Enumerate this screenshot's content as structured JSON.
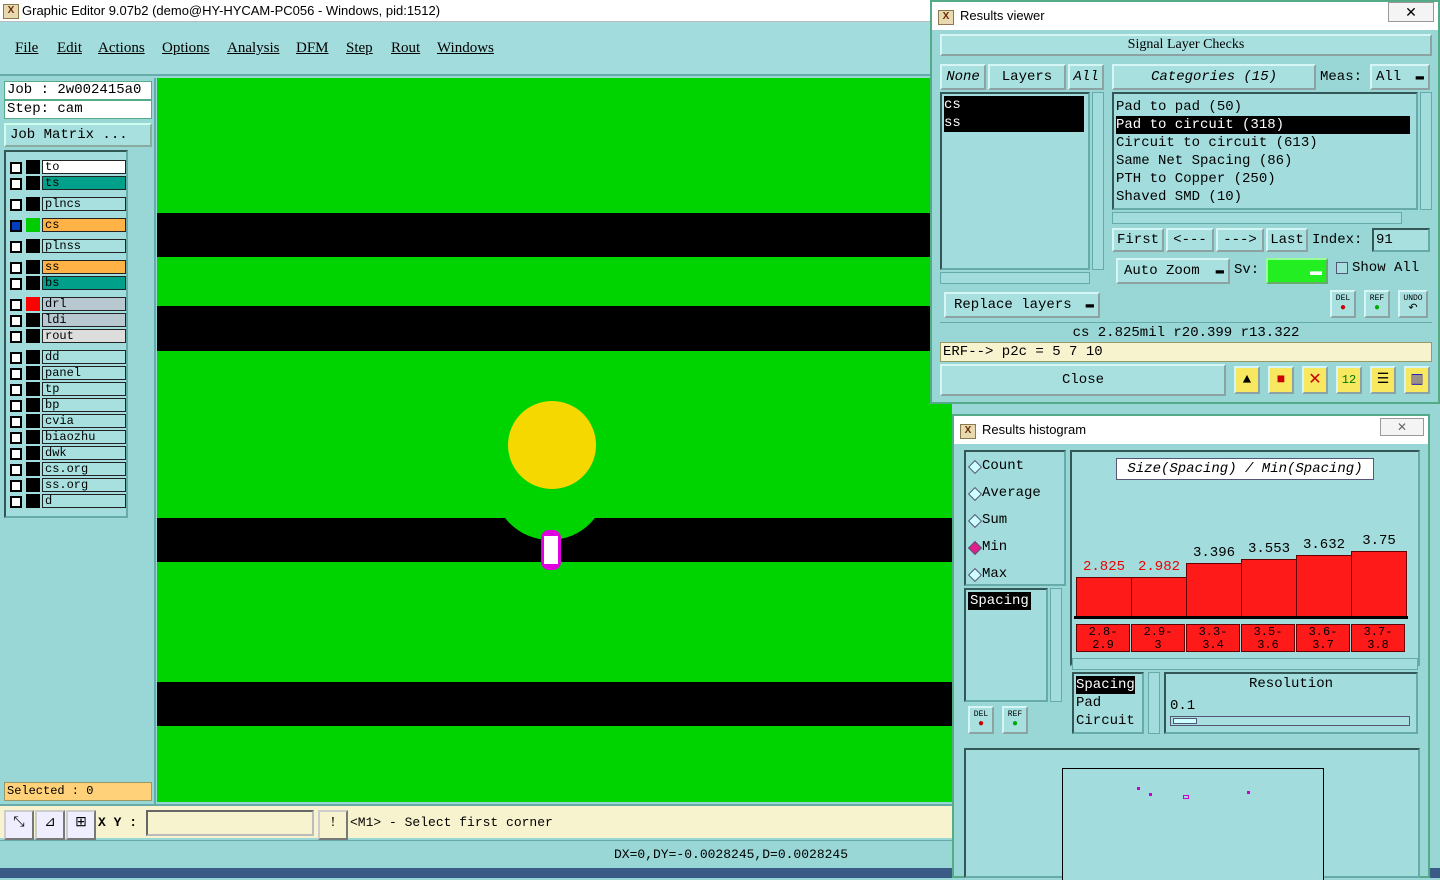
{
  "main_window": {
    "title": "Graphic Editor 9.07b2 (demo@HY-HYCAM-PC056 - Windows, pid:1512)",
    "menu": [
      "File",
      "Edit",
      "Actions",
      "Options",
      "Analysis",
      "DFM",
      "Step",
      "Rout",
      "Windows"
    ]
  },
  "left_panel": {
    "job": "Job : 2w002415a0",
    "step": "Step: cam",
    "job_matrix": "Job Matrix ...",
    "layers": [
      {
        "name": "to",
        "color": "#ffffff",
        "swatch": "#000000"
      },
      {
        "name": "ts",
        "color": "#00a08a",
        "swatch": "#000000"
      },
      {
        "name": "plncs",
        "color": "#a8e0e0",
        "swatch": "#000000"
      },
      {
        "name": "cs",
        "color": "#ffb347",
        "swatch": "#00cc00",
        "active": true
      },
      {
        "name": "plnss",
        "color": "#a8e0e0",
        "swatch": "#000000"
      },
      {
        "name": "ss",
        "color": "#ffb347",
        "swatch": "#000000"
      },
      {
        "name": "bs",
        "color": "#00a08a",
        "swatch": "#000000"
      },
      {
        "name": "drl",
        "color": "#b8c8d0",
        "swatch": "#ff0000"
      },
      {
        "name": "ldi",
        "color": "#b8c8d0",
        "swatch": "#000000"
      },
      {
        "name": "rout",
        "color": "#dddddd",
        "swatch": "#000000"
      },
      {
        "name": "dd",
        "color": "#a8e0e0",
        "swatch": "#000000"
      },
      {
        "name": "panel",
        "color": "#a8e0e0",
        "swatch": "#000000"
      },
      {
        "name": "tp",
        "color": "#a8e0e0",
        "swatch": "#000000"
      },
      {
        "name": "bp",
        "color": "#a8e0e0",
        "swatch": "#000000"
      },
      {
        "name": "cvia",
        "color": "#a8e0e0",
        "swatch": "#000000"
      },
      {
        "name": "biaozhu",
        "color": "#a8e0e0",
        "swatch": "#000000"
      },
      {
        "name": "dwk",
        "color": "#a8e0e0",
        "swatch": "#000000"
      },
      {
        "name": "cs.org",
        "color": "#a8e0e0",
        "swatch": "#000000"
      },
      {
        "name": "ss.org",
        "color": "#a8e0e0",
        "swatch": "#000000"
      },
      {
        "name": "d",
        "color": "#a8e0e0",
        "swatch": "#000000"
      }
    ],
    "selected": "Selected : 0"
  },
  "status": {
    "xy_label": "X Y :",
    "xy_value": "",
    "message": "<M1> - Select first corner",
    "dx": "DX=0,DY=-0.0028245,D=0.0028245"
  },
  "results_viewer": {
    "title": "Results viewer",
    "header": "Signal Layer Checks",
    "none_label": "None",
    "layers_label": "Layers",
    "all_label": "All",
    "categories_label": "Categories (15)",
    "meas_label": "Meas:",
    "meas_value": "All",
    "layers": [
      "cs",
      "ss"
    ],
    "categories": [
      "Pad to pad (50)",
      "Pad to circuit (318)",
      "Circuit to circuit (613)",
      "Same Net Spacing (86)",
      "PTH to Copper (250)",
      "Shaved SMD (10)"
    ],
    "selected_category": 1,
    "first_label": "First",
    "prev_label": "<---",
    "next_label": "--->",
    "last_label": "Last",
    "index_label": "Index:",
    "index_value": "91",
    "auto_zoom": "Auto Zoom",
    "sv_label": "Sv:",
    "show_all": "Show All",
    "replace_layers": "Replace layers",
    "del_label": "DEL",
    "ref_label": "REF",
    "undo_label": "UNDO",
    "measure_line": "cs 2.825mil  r20.399  r13.322",
    "erf_line": "ERF--> p2c = 5 7 10",
    "close_label": "Close"
  },
  "histogram": {
    "title": "Results histogram",
    "modes": [
      "Count",
      "Average",
      "Sum",
      "Min",
      "Max"
    ],
    "selected_mode": "Min",
    "list_item": "Spacing",
    "chart_title": "Size(Spacing) / Min(Spacing)",
    "bars": [
      {
        "value": "2.825",
        "range": "2.8-2.9",
        "level": 0.55,
        "highlight": true
      },
      {
        "value": "2.982",
        "range": "2.9-3",
        "level": 0.55,
        "highlight": true
      },
      {
        "value": "3.396",
        "range": "3.3-3.4",
        "level": 0.75,
        "highlight": false
      },
      {
        "value": "3.553",
        "range": "3.5-3.6",
        "level": 0.82,
        "highlight": false
      },
      {
        "value": "3.632",
        "range": "3.6-3.7",
        "level": 0.87,
        "highlight": false
      },
      {
        "value": "3.75",
        "range": "3.7-3.8",
        "level": 0.93,
        "highlight": false
      }
    ],
    "size_options": [
      "Spacing",
      "Pad",
      "Circuit"
    ],
    "resolution_label": "Resolution",
    "resolution_value": "0.1",
    "del_label": "DEL",
    "ref_label": "REF"
  }
}
